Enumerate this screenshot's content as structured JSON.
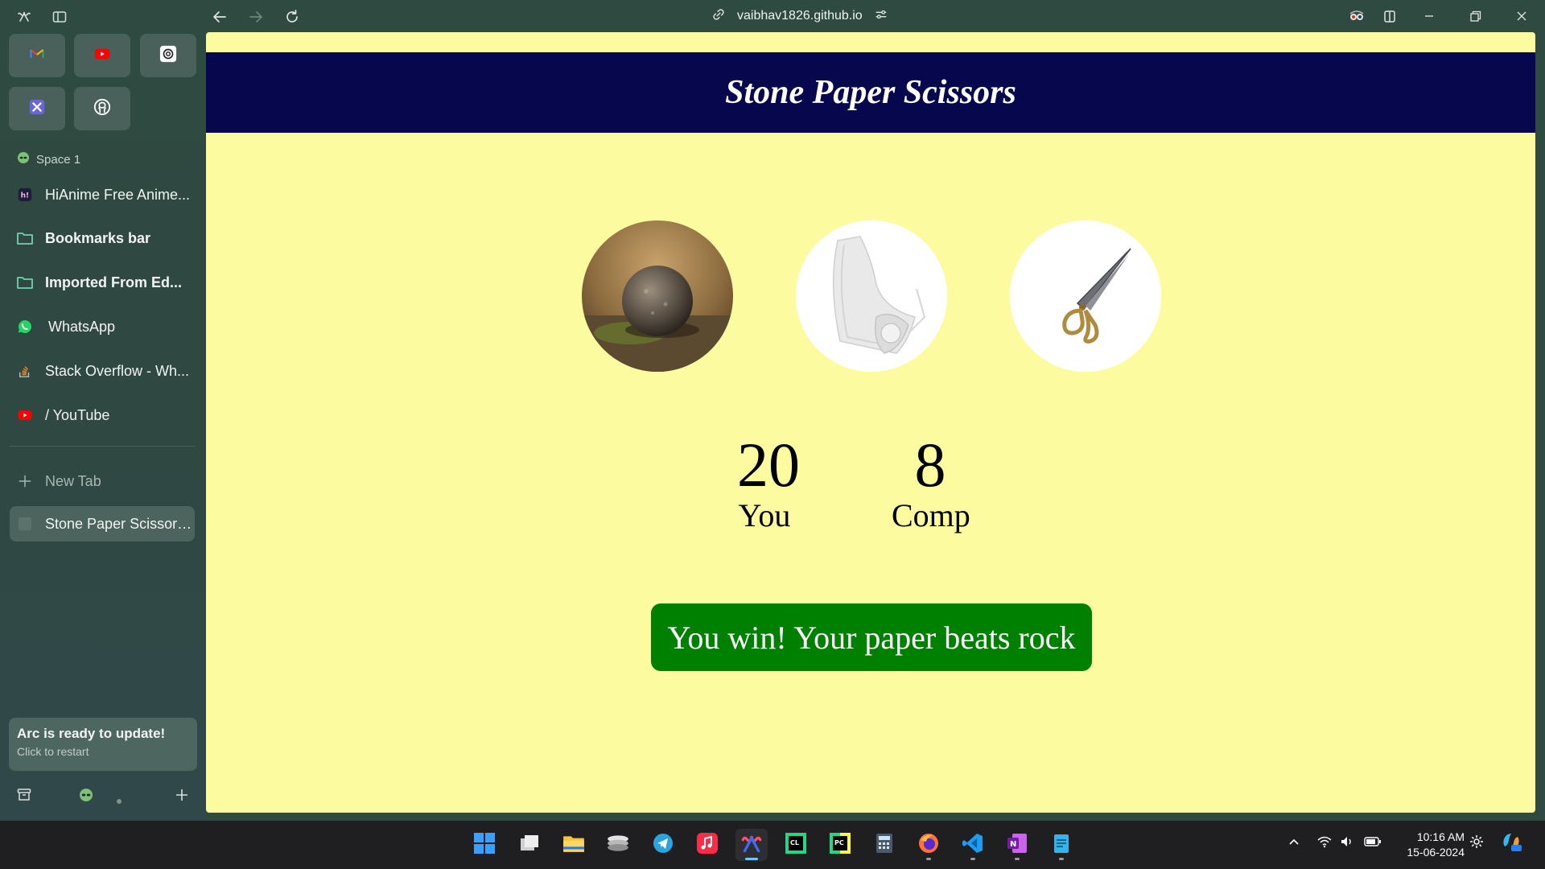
{
  "browser": {
    "url": "vaibhav1826.github.io"
  },
  "sidebar": {
    "space_label": "Space 1",
    "favorites": [
      {
        "name": "Gmail"
      },
      {
        "name": "YouTube"
      },
      {
        "name": "ChatGPT"
      },
      {
        "name": "Excalidraw"
      },
      {
        "name": "GitHub"
      }
    ],
    "pinned": [
      {
        "label": "HiAnime Free Anime...",
        "icon": "hianime-icon"
      },
      {
        "label": "Bookmarks bar",
        "icon": "folder-icon"
      },
      {
        "label": "Imported From Ed...",
        "icon": "folder-icon"
      },
      {
        "label": "WhatsApp",
        "icon": "whatsapp-icon"
      },
      {
        "label": "Stack Overflow - Wh...",
        "icon": "stackoverflow-icon"
      },
      {
        "label": "/ YouTube",
        "icon": "youtube-icon"
      }
    ],
    "new_tab_label": "New Tab",
    "active_tab_label": "Stone Paper Scissors...",
    "update": {
      "title": "Arc is ready to update!",
      "subtitle": "Click to restart"
    }
  },
  "page": {
    "title": "Stone Paper Scissors",
    "choices": [
      "rock",
      "paper",
      "scissors"
    ],
    "user_score": "20",
    "user_label": "You",
    "comp_score": "8",
    "comp_label": "Comp",
    "message": "You win! Your paper beats rock",
    "colors": {
      "background": "#fdfb9f",
      "header": "#06074c",
      "message_bg": "#008000"
    }
  },
  "taskbar": {
    "time": "10:16 AM",
    "date": "15-06-2024",
    "apps": [
      "windows-start",
      "task-view",
      "file-explorer",
      "terminal",
      "telegram",
      "apple-music",
      "arc",
      "clion",
      "pycharm",
      "calculator",
      "firefox",
      "vscode",
      "onenote",
      "notepad"
    ]
  }
}
